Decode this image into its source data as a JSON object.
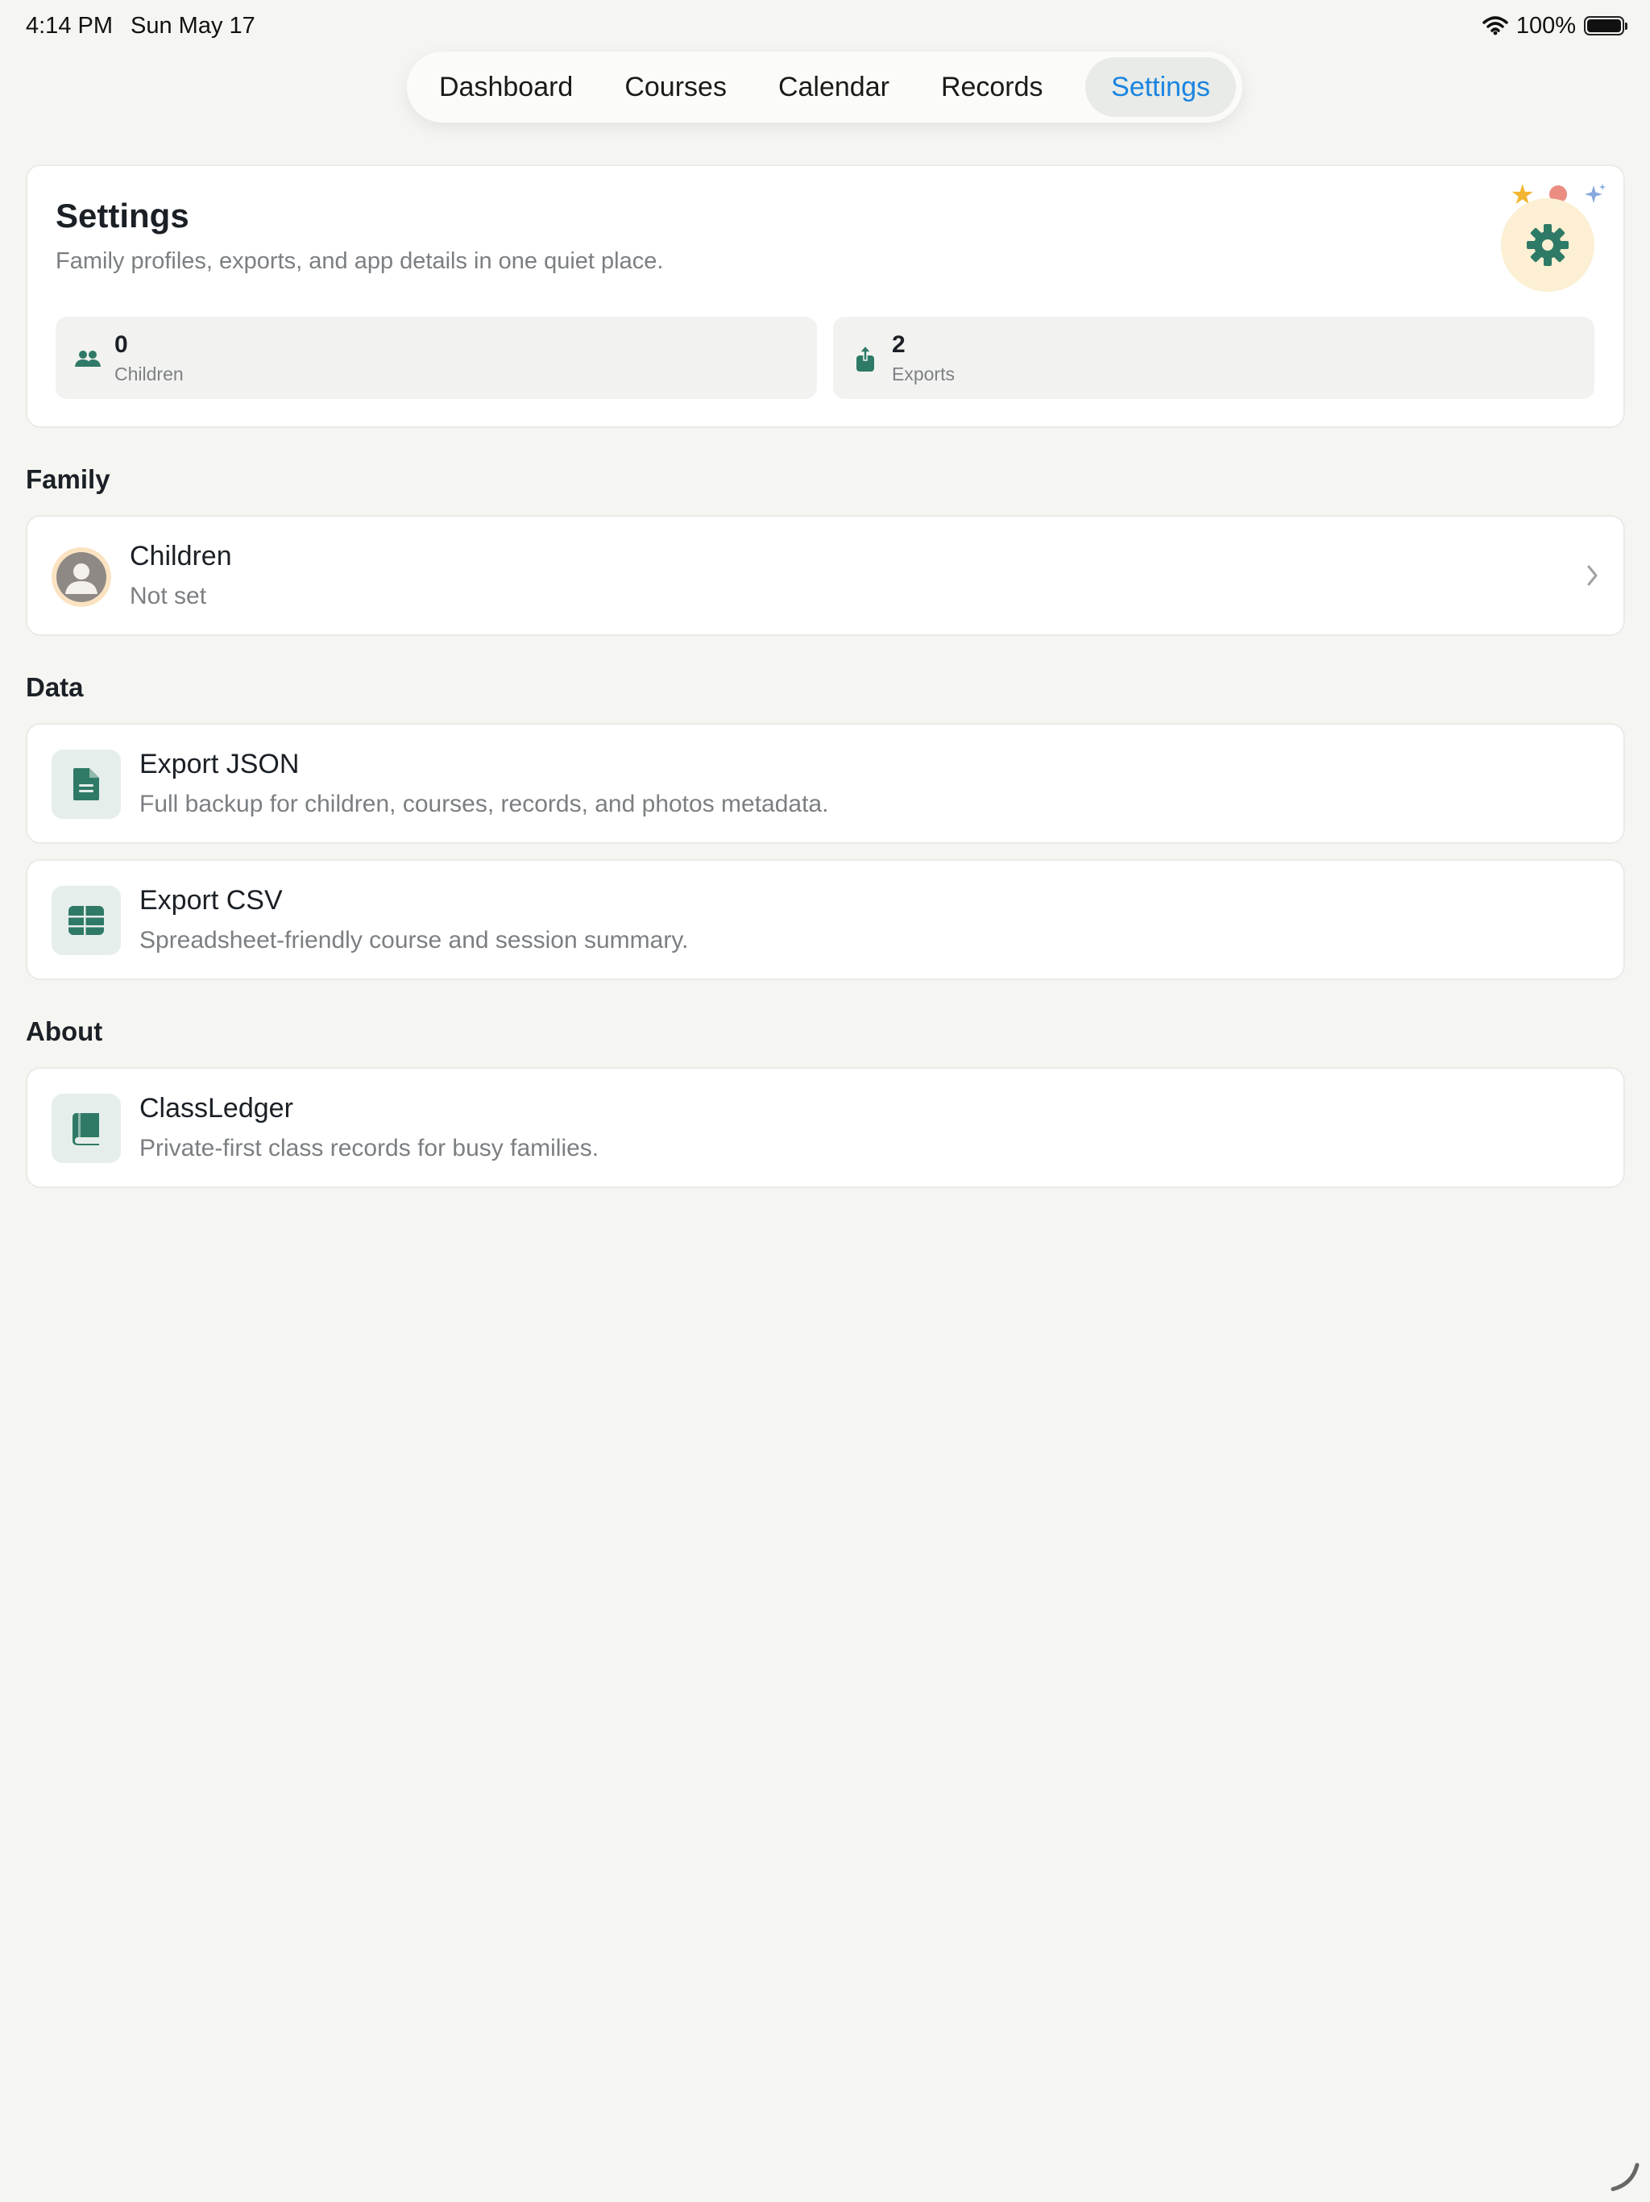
{
  "status_bar": {
    "time": "4:14 PM",
    "date": "Sun May 17",
    "battery_percent": "100%"
  },
  "tabs": [
    {
      "label": "Dashboard",
      "active": false
    },
    {
      "label": "Courses",
      "active": false
    },
    {
      "label": "Calendar",
      "active": false
    },
    {
      "label": "Records",
      "active": false
    },
    {
      "label": "Settings",
      "active": true
    }
  ],
  "hero": {
    "title": "Settings",
    "subtitle": "Family profiles, exports, and app details in one quiet place.",
    "badge_icon": "gear-icon",
    "stats": [
      {
        "value": "0",
        "label": "Children",
        "icon": "people-icon"
      },
      {
        "value": "2",
        "label": "Exports",
        "icon": "share-icon"
      }
    ]
  },
  "sections": {
    "family": {
      "title": "Family",
      "children_row": {
        "title": "Children",
        "subtitle": "Not set",
        "icon": "person-avatar-icon"
      }
    },
    "data": {
      "title": "Data",
      "export_json": {
        "title": "Export JSON",
        "subtitle": "Full backup for children, courses, records, and photos metadata.",
        "icon": "document-icon"
      },
      "export_csv": {
        "title": "Export CSV",
        "subtitle": "Spreadsheet-friendly course and session summary.",
        "icon": "table-icon"
      }
    },
    "about": {
      "title": "About",
      "app": {
        "title": "ClassLedger",
        "subtitle": "Private-first class records for busy families.",
        "icon": "book-icon"
      }
    }
  },
  "colors": {
    "background": "#f5f6f2",
    "accent_blue": "#1a84e0",
    "icon_green": "#2f7a66",
    "badge_cream": "#fcefd3"
  }
}
